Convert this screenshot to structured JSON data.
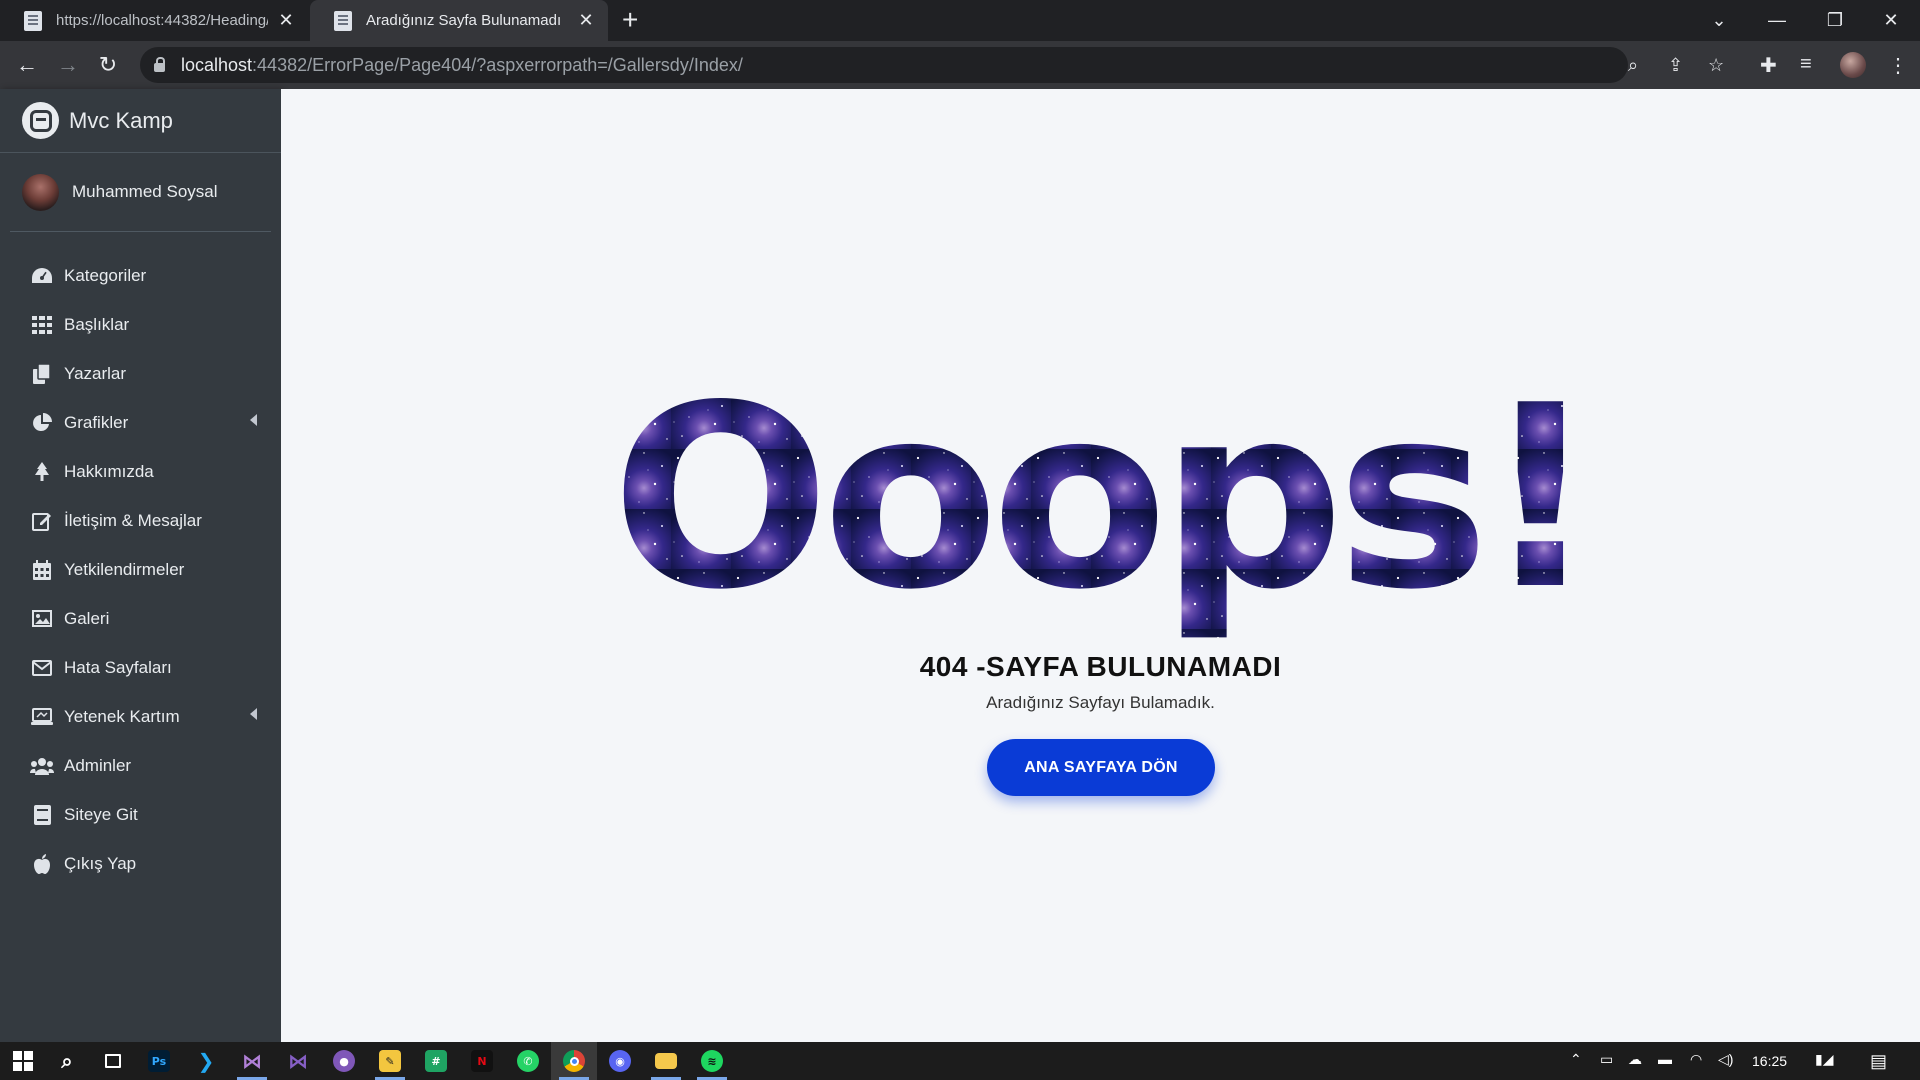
{
  "browser": {
    "tabs": [
      {
        "title": "https://localhost:44382/Heading/",
        "active": false
      },
      {
        "title": "Aradığınız Sayfa Bulunamadı",
        "active": true
      }
    ],
    "url_host": "localhost",
    "url_rest": ":44382/ErrorPage/Page404/?aspxerrorpath=/Gallersdy/Index/"
  },
  "sidebar": {
    "brand": "Mvc Kamp",
    "user_name": "Muhammed Soysal",
    "items": [
      {
        "label": "Kategoriler",
        "icon": "dashboard-icon",
        "has_submenu": false
      },
      {
        "label": "Başlıklar",
        "icon": "grid-icon",
        "has_submenu": false
      },
      {
        "label": "Yazarlar",
        "icon": "copy-icon",
        "has_submenu": false
      },
      {
        "label": "Grafikler",
        "icon": "pie-chart-icon",
        "has_submenu": true
      },
      {
        "label": "Hakkımızda",
        "icon": "tree-icon",
        "has_submenu": false
      },
      {
        "label": "İletişim & Mesajlar",
        "icon": "edit-icon",
        "has_submenu": false
      },
      {
        "label": "Yetkilendirmeler",
        "icon": "calendar-icon",
        "has_submenu": false
      },
      {
        "label": "Galeri",
        "icon": "image-icon",
        "has_submenu": false
      },
      {
        "label": "Hata Sayfaları",
        "icon": "envelope-icon",
        "has_submenu": false
      },
      {
        "label": "Yetenek Kartım",
        "icon": "laptop-icon",
        "has_submenu": true
      },
      {
        "label": "Adminler",
        "icon": "users-icon",
        "has_submenu": false
      },
      {
        "label": "Siteye Git",
        "icon": "book-icon",
        "has_submenu": false
      },
      {
        "label": "Çıkış Yap",
        "icon": "apple-icon",
        "has_submenu": false
      }
    ]
  },
  "error_page": {
    "big_text": "Ooops!",
    "heading": "404 -SAYFA BULUNAMADI",
    "subtext": "Aradığınız Sayfayı Bulamadık.",
    "button_label": "ANA SAYFAYA DÖN"
  },
  "taskbar": {
    "clock": "16:25"
  },
  "colors": {
    "sidebar_bg": "#343a40",
    "content_bg": "#f4f6f9",
    "button_bg": "#0a3bd6",
    "chrome_dark": "#202124"
  }
}
